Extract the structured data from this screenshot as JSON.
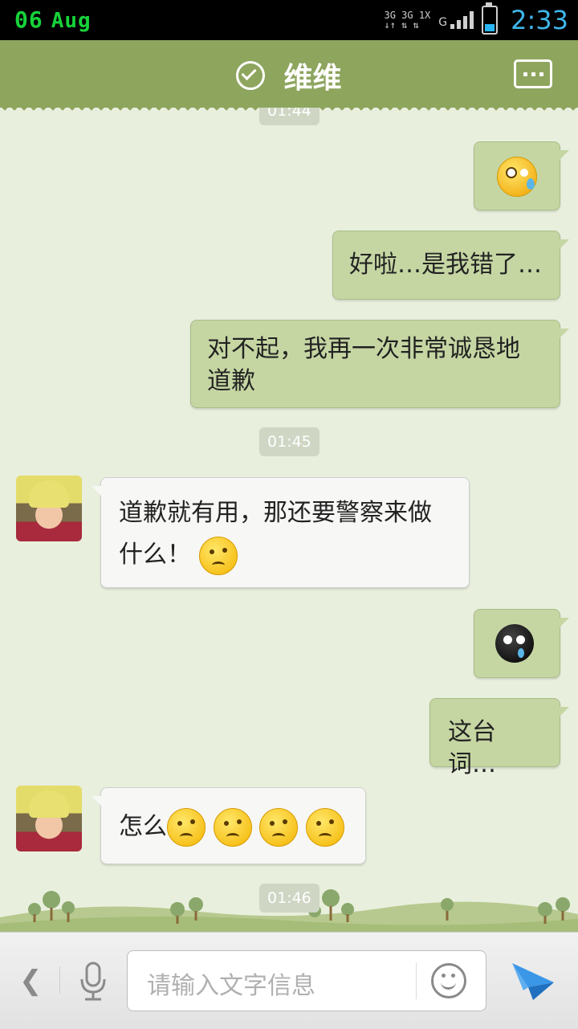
{
  "status_bar": {
    "day": "06",
    "month": "Aug",
    "network_top": "3G 3G 1X",
    "network_g": "G",
    "time": "2:33"
  },
  "header": {
    "title": "维维"
  },
  "timestamps": {
    "top_partial": "01:44",
    "t1": "01:45",
    "t2": "01:46"
  },
  "messages": [
    {
      "from": "me",
      "type": "emoji",
      "emoji": "sweat-face-icon"
    },
    {
      "from": "me",
      "text": "好啦…是我错了…"
    },
    {
      "from": "me",
      "text": "对不起，我再一次非常诚恳地道歉"
    },
    {
      "from": "weiwei",
      "text": "道歉就有用，那还要警察来做什么！",
      "emoji": "puzzled-face-icon"
    },
    {
      "from": "me",
      "type": "emoji",
      "emoji": "crying-black-face-icon"
    },
    {
      "from": "me",
      "text": "这台词…"
    },
    {
      "from": "weiwei",
      "text": "怎么",
      "emoji_count": 4
    }
  ],
  "input": {
    "placeholder": "请输入文字信息"
  },
  "colors": {
    "header": "#8ea55e",
    "out_bubble": "#c5d6a3",
    "in_bubble": "#f7f7f5",
    "background": "#e9efdd",
    "time_blue": "#3fb6ea",
    "send_blue": "#2f86d6"
  }
}
